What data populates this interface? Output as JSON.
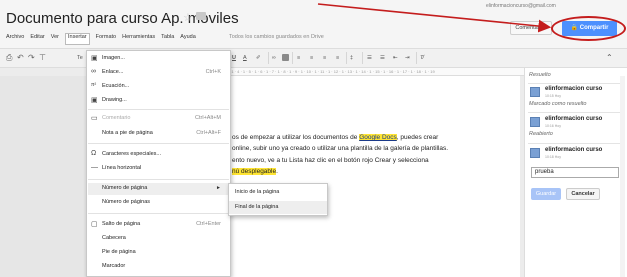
{
  "app": {
    "doc_title": "Documento para curso Ap. moviles",
    "user_email": "elinformacioncurso@gmail.com",
    "comments_label": "Comentarios",
    "share_label": "Compartir"
  },
  "menubar": {
    "items": [
      "Archivo",
      "Editar",
      "Ver",
      "Insertar",
      "Formato",
      "Herramientas",
      "Tabla",
      "Ayuda"
    ],
    "active": "Insertar",
    "save_status": "Todos los cambios guardados en Drive"
  },
  "toolbar": {
    "font_label": "Te",
    "ruler": "· 1 · 1 · 2 · 1 · 3 · 1 · 4 · 1 · 5 · 1 · 6 · 1 · 7 · 1 · 8 · 1 · 9 · 1 · 10 · 1 · 11 · 1 · 12 · 1 · 13 · 1 · 14 · 1 · 15 · 1 · 16 · 1 · 17 · 1 · 18 · 1 · 19"
  },
  "insert_menu": {
    "items": [
      {
        "label": "Imagen...",
        "shortcut": "",
        "icon": "image-icon"
      },
      {
        "label": "Enlace...",
        "shortcut": "Ctrl+K",
        "icon": "link-icon"
      },
      {
        "label": "Ecuación...",
        "shortcut": "",
        "icon": "equation-icon"
      },
      {
        "label": "Drawing...",
        "shortcut": "",
        "icon": "drawing-icon"
      },
      {
        "label": "Comentario",
        "shortcut": "Ctrl+Alt+M",
        "icon": "comment-icon"
      },
      {
        "label": "Nota a pie de página",
        "shortcut": "Ctrl+Alt+F",
        "icon": ""
      },
      {
        "label": "Caracteres especiales...",
        "shortcut": "",
        "icon": "omega-icon"
      },
      {
        "label": "Línea horizontal",
        "shortcut": "",
        "icon": "horizontal-line-icon"
      },
      {
        "label": "Número de página",
        "shortcut": "",
        "icon": ""
      },
      {
        "label": "Número de páginas",
        "shortcut": "",
        "icon": ""
      },
      {
        "label": "Salto de página",
        "shortcut": "Ctrl+Enter",
        "icon": "page-break-icon"
      },
      {
        "label": "Cabecera",
        "shortcut": "",
        "icon": ""
      },
      {
        "label": "Pie de página",
        "shortcut": "",
        "icon": ""
      },
      {
        "label": "Marcador",
        "shortcut": "",
        "icon": ""
      }
    ],
    "submenu": [
      "Inicio de la página",
      "Final de la página"
    ]
  },
  "document": {
    "line1_pre": "os de empezar a utilizar los documentos de ",
    "line1_link": "Google Docs",
    "line1_post": ", puedes crear",
    "line2": "online, subir uno ya creado o utilizar una plantilla de la galería de plantillas.",
    "line3": "ento nuevo, ve a tu Lista  haz clic en el botón rojo  Crear y selecciona",
    "line4_hl": "nú desplegable",
    "line4_post": "."
  },
  "comments_panel": {
    "status1": "Resuelto",
    "card1": {
      "name": "elinformacion curso",
      "time": "10:15 Hoy",
      "text": "Marcado como resuelto"
    },
    "card2": {
      "name": "elinformacion curso",
      "time": "10:16 Hoy",
      "text": "Reabierto"
    },
    "card3": {
      "name": "elinformacion curso",
      "time": "10:18 Hoy",
      "text": "prueba"
    },
    "reply_btn": "Guardar",
    "cancel_btn": "Cancelar"
  },
  "colors": {
    "share_button": "#4d90fe",
    "annotation": "#c41d1d",
    "highlight": "#ffe533"
  }
}
